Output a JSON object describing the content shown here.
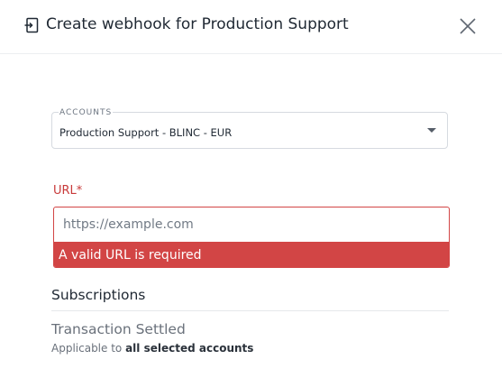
{
  "dialog": {
    "title": "Create webhook for Production Support",
    "title_icon": "webhook-icon",
    "close_icon": "close-icon"
  },
  "accounts": {
    "label": "ACCOUNTS",
    "value": "Production Support - BLINC - EUR",
    "caret_icon": "caret-down-icon"
  },
  "url": {
    "label": "URL*",
    "placeholder": "https://example.com",
    "value": "",
    "error": "A valid URL is required"
  },
  "subscriptions": {
    "heading": "Subscriptions",
    "items": [
      {
        "name": "Transaction Settled",
        "desc_prefix": "Applicable to ",
        "desc_emphasis": "all selected accounts"
      }
    ]
  },
  "colors": {
    "error": "#d24545",
    "text": "#222b36",
    "muted": "#6a717b",
    "border": "#d6dae0"
  }
}
